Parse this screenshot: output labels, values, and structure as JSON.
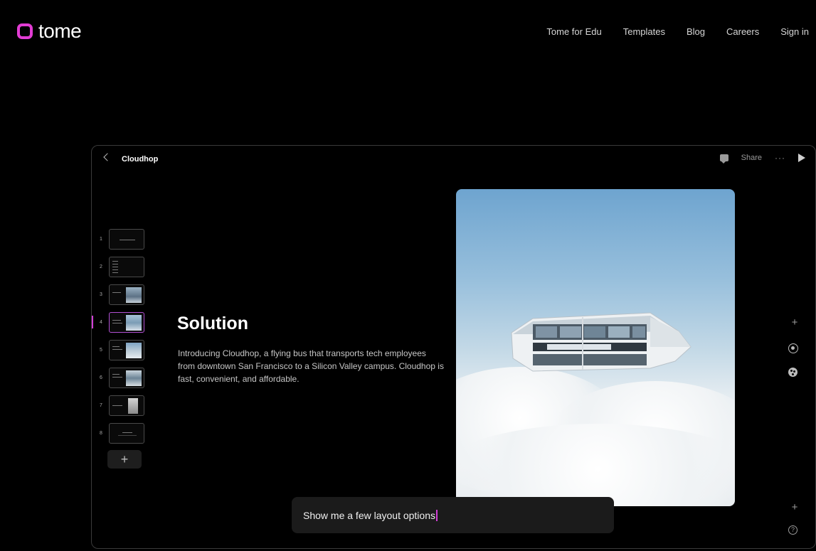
{
  "brand": {
    "name": "tome",
    "accent": "#e23cd3"
  },
  "nav": [
    "Tome for Edu",
    "Templates",
    "Blog",
    "Careers",
    "Sign in"
  ],
  "editor": {
    "title": "Cloudhop",
    "share_label": "Share",
    "more_label": "···",
    "thumbnails": [
      {
        "num": "1"
      },
      {
        "num": "2"
      },
      {
        "num": "3"
      },
      {
        "num": "4",
        "active": true
      },
      {
        "num": "5"
      },
      {
        "num": "6"
      },
      {
        "num": "7"
      },
      {
        "num": "8"
      }
    ],
    "add_label": "+"
  },
  "slide": {
    "title": "Solution",
    "body": "Introducing Cloudhop, a flying bus that transports tech employees from downtown San Francisco to a Silicon Valley campus. Cloudhop is fast, convenient, and affordable."
  },
  "tools": {
    "add": "+",
    "sparkle_add": "+",
    "help": "?"
  },
  "prompt": {
    "value": "Show me a few layout options"
  }
}
